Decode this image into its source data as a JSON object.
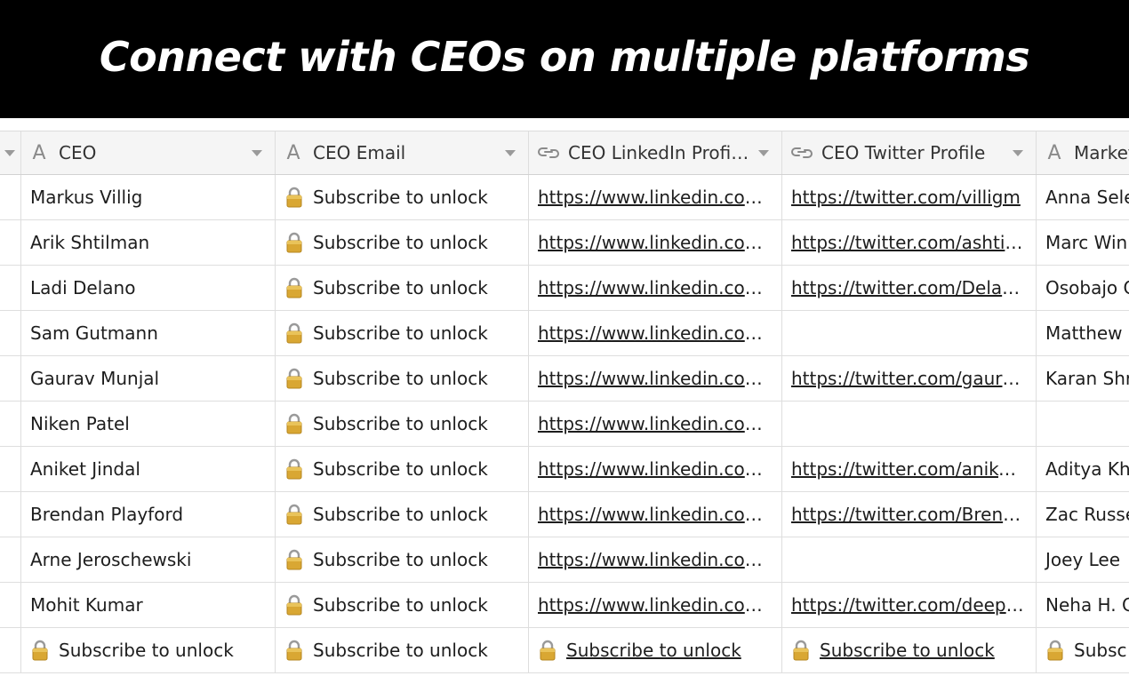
{
  "banner": {
    "title": "Connect with CEOs on multiple platforms"
  },
  "headers": [
    {
      "label": "CEO",
      "icon": "text-field-icon"
    },
    {
      "label": "CEO Email",
      "icon": "text-field-icon"
    },
    {
      "label": "CEO LinkedIn Profil...",
      "icon": "url-field-icon"
    },
    {
      "label": "CEO Twitter Profile",
      "icon": "url-field-icon"
    },
    {
      "label": "Market",
      "icon": "text-field-icon"
    }
  ],
  "rows": [
    {
      "ceo": "Markus Villig",
      "email": "Subscribe to unlock",
      "linkedin": "https://www.linkedin.com/...",
      "twitter": "https://twitter.com/villigm",
      "market": "Anna Sele"
    },
    {
      "ceo": "Arik Shtilman",
      "email": "Subscribe to unlock",
      "linkedin": "https://www.linkedin.com/...",
      "twitter": "https://twitter.com/ashtil...",
      "market": "Marc Wini"
    },
    {
      "ceo": "Ladi Delano",
      "email": "Subscribe to unlock",
      "linkedin": "https://www.linkedin.com/...",
      "twitter": "https://twitter.com/Delan...",
      "market": "Osobajo C"
    },
    {
      "ceo": "Sam Gutmann",
      "email": "Subscribe to unlock",
      "linkedin": "https://www.linkedin.com/...",
      "twitter": "",
      "market": "Matthew I"
    },
    {
      "ceo": "Gaurav Munjal",
      "email": "Subscribe to unlock",
      "linkedin": "https://www.linkedin.com/...",
      "twitter": "https://twitter.com/gaurav...",
      "market": "Karan Shr"
    },
    {
      "ceo": "Niken Patel",
      "email": "Subscribe to unlock",
      "linkedin": "https://www.linkedin.com/...",
      "twitter": "",
      "market": ""
    },
    {
      "ceo": "Aniket Jindal",
      "email": "Subscribe to unlock",
      "linkedin": "https://www.linkedin.com/...",
      "twitter": "https://twitter.com/aniket...",
      "market": "Aditya Kha"
    },
    {
      "ceo": "Brendan Playford",
      "email": "Subscribe to unlock",
      "linkedin": "https://www.linkedin.com/...",
      "twitter": "https://twitter.com/Brend...",
      "market": "Zac Russe"
    },
    {
      "ceo": "Arne Jeroschewski",
      "email": "Subscribe to unlock",
      "linkedin": "https://www.linkedin.com/...",
      "twitter": "",
      "market": "Joey Lee"
    },
    {
      "ceo": "Mohit Kumar",
      "email": "Subscribe to unlock",
      "linkedin": "https://www.linkedin.com/...",
      "twitter": "https://twitter.com/deepp...",
      "market": "Neha H. C"
    }
  ],
  "locked_row": {
    "ceo": "Subscribe to unlock",
    "email": "Subscribe to unlock",
    "linkedin": "Subscribe to unlock",
    "twitter": "Subscribe to unlock",
    "market": "Subsc"
  },
  "colors": {
    "banner_bg": "#000000",
    "header_bg": "#f5f5f5",
    "grid_line": "#dedede",
    "icon_gray": "#8a8a8a"
  }
}
